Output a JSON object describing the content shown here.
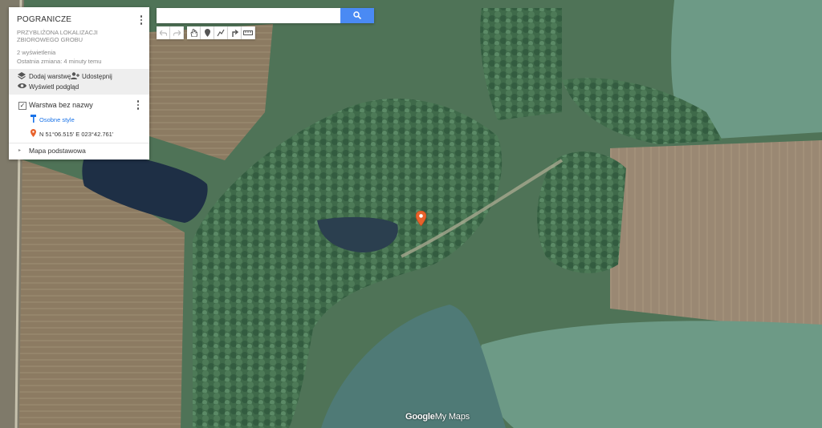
{
  "map": {
    "title": "POGRANICZE",
    "description": "PRZYBLIŻONA LOKALIZACJI ZBIOROWEGO GROBU",
    "views": "2 wyświetlenia",
    "last_change": "Ostatnia zmiana: 4 minuty temu"
  },
  "actions": {
    "add_layer": "Dodaj warstwę",
    "share": "Udostępnij",
    "preview": "Wyświetl podgląd"
  },
  "layer": {
    "name": "Warstwa bez nazwy",
    "checked": true,
    "style_label": "Osobne style",
    "location_label": "N 51°06.515' E 023°42.761'"
  },
  "base_map": {
    "label": "Mapa podstawowa"
  },
  "search": {
    "value": "",
    "placeholder": ""
  },
  "toolbar": {
    "tools": [
      "undo-icon",
      "redo-icon",
      "hand-icon",
      "marker-icon",
      "draw-line-icon",
      "directions-icon",
      "measure-icon"
    ]
  },
  "marker": {
    "color": "#e8622c"
  },
  "logo": {
    "google": "Google",
    "mymaps": "My Maps"
  },
  "colors": {
    "accent": "#4a8af4",
    "link": "#1a73e8",
    "marker": "#e8622c"
  }
}
